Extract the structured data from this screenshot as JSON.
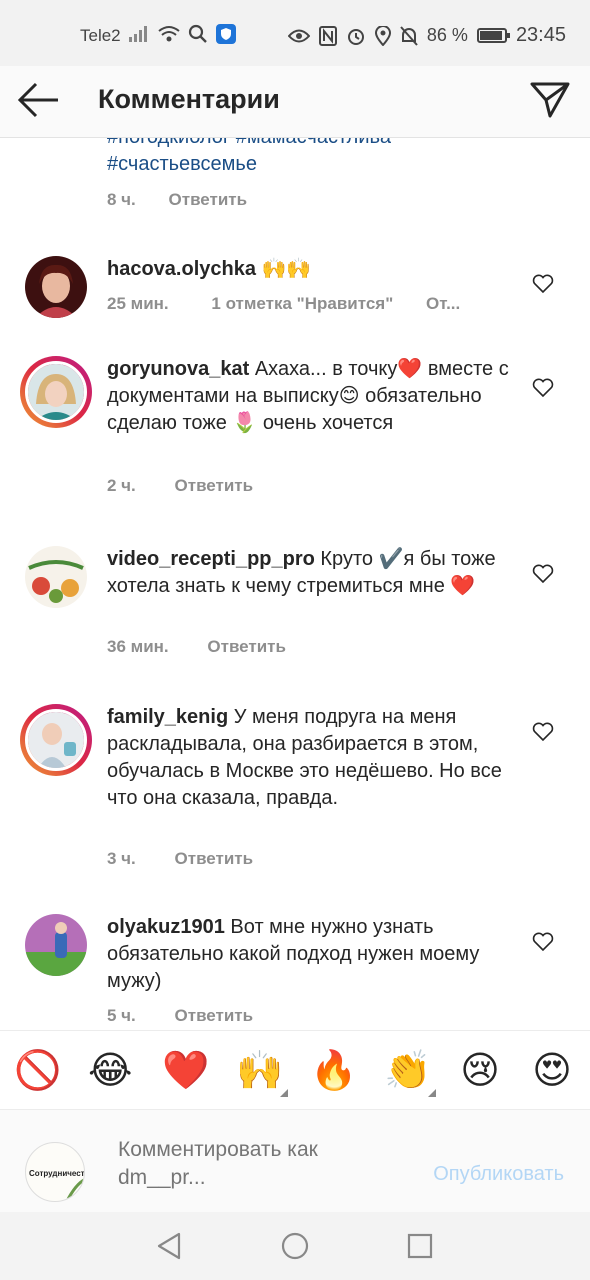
{
  "status_bar": {
    "carrier": "Tele2",
    "battery": "86 %",
    "battery_level": 0.86,
    "time": "23:45"
  },
  "header": {
    "title": "Комментарии"
  },
  "partial_comment": {
    "line1": "#погодкиолог #мамасчастлива",
    "line2": "#счастьевсемье",
    "time": "8 ч.",
    "reply": "Ответить"
  },
  "comments": [
    {
      "username": "hacova.olychka",
      "text": "🙌🙌",
      "time": "25 мин.",
      "likes": "1 отметка \"Нравится\"",
      "reply": "От..."
    },
    {
      "username": "goryunova_kat",
      "text": "Ахаха... в точку❤️ вместе с документами на выписку😊 обязательно сделаю тоже 🌷 очень хочется",
      "time": "2 ч.",
      "reply": "Ответить"
    },
    {
      "username": "video_recepti_pp_pro",
      "text": "Круто ✔️я бы тоже хотела знать к чему стремиться мне ❤️",
      "time": "36 мин.",
      "reply": "Ответить"
    },
    {
      "username": "family_kenig",
      "text": "У меня подруга на меня раскладывала, она разбирается в этом, обучалась в Москве это недёшево. Но все что она сказала, правда.",
      "time": "3 ч.",
      "reply": "Ответить"
    },
    {
      "username": "olyakuz1901",
      "text": "Вот мне нужно узнать обязательно какой подход нужен моему мужу)",
      "time": "5 ч.",
      "reply": "Ответить"
    }
  ],
  "emoji_bar": [
    "🚫",
    "😂",
    "❤️",
    "🙌",
    "🔥",
    "👏",
    "😢",
    "😍"
  ],
  "composer": {
    "placeholder": "Комментировать как dm__pr...",
    "avatar_label": "Сотрудничество",
    "publish": "Опубликовать"
  },
  "colors": {
    "hashtag": "#1b4e86",
    "meta": "#8e8e8e",
    "publish_disabled": "#b3d6f5",
    "story_ring": "#dc2743"
  }
}
